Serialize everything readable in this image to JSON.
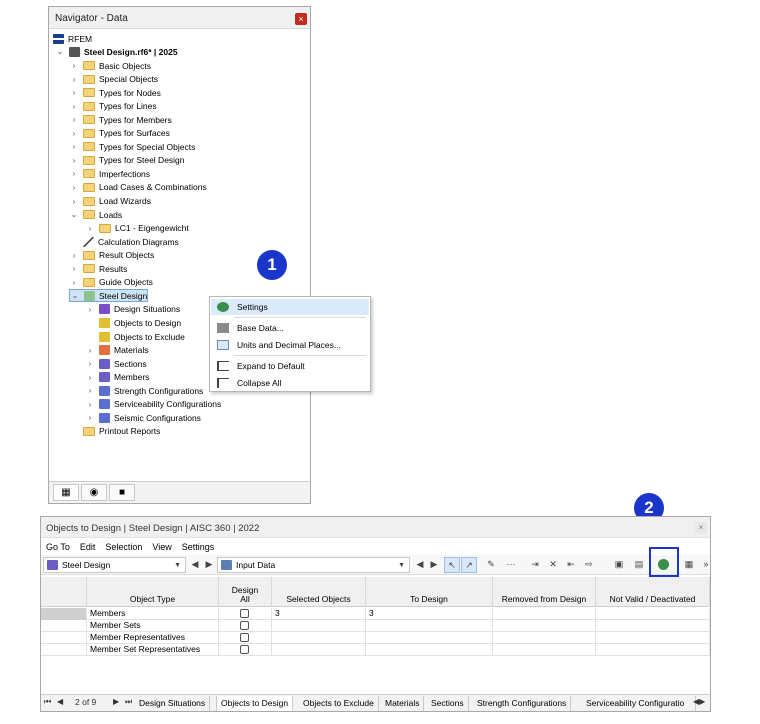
{
  "navigator": {
    "title": "Navigator - Data",
    "root": "RFEM",
    "project": "Steel Design.rf6* | 2025",
    "items": [
      "Basic Objects",
      "Special Objects",
      "Types for Nodes",
      "Types for Lines",
      "Types for Members",
      "Types for Surfaces",
      "Types for Special Objects",
      "Types for Steel Design",
      "Imperfections",
      "Load Cases & Combinations",
      "Load Wizards",
      "Loads"
    ],
    "loads_child": "LC1 - Eigengewicht",
    "after_loads": [
      "Calculation Diagrams",
      "Result Objects",
      "Results",
      "Guide Objects"
    ],
    "steel_design": "Steel Design",
    "steel_children": [
      "Design Situations",
      "Objects to Design",
      "Objects to Exclude",
      "Materials",
      "Sections",
      "Members",
      "Strength Configurations",
      "Serviceability Configurations",
      "Seismic Configurations"
    ],
    "printout": "Printout Reports"
  },
  "context_menu": {
    "items": [
      "Settings",
      "Base Data...",
      "Units and Decimal Places...",
      "Expand to Default",
      "Collapse All"
    ]
  },
  "callouts": [
    "1",
    "2"
  ],
  "window": {
    "title": "Objects to Design | Steel Design | AISC 360 | 2022",
    "menu": [
      "Go To",
      "Edit",
      "Selection",
      "View",
      "Settings"
    ],
    "module_combo": "Steel Design",
    "data_combo": "Input Data",
    "columns": [
      "Object Type",
      "Design\nAll",
      "Selected Objects",
      "To Design",
      "Removed from Design",
      "Not Valid / Deactivated"
    ],
    "rows": [
      {
        "type": "Members",
        "selected": "3",
        "to_design": "3"
      },
      {
        "type": "Member Sets",
        "selected": "",
        "to_design": ""
      },
      {
        "type": "Member Representatives",
        "selected": "",
        "to_design": ""
      },
      {
        "type": "Member Set Representatives",
        "selected": "",
        "to_design": ""
      }
    ],
    "page_indicator": "2 of 9",
    "tabs": [
      "Design Situations",
      "Objects to Design",
      "Objects to Exclude",
      "Materials",
      "Sections",
      "Strength Configurations",
      "Serviceability Configuratio"
    ]
  },
  "colors": {
    "accent": "#1a35c9",
    "selection": "#cfe3f7",
    "folder": "#f5d37a"
  }
}
